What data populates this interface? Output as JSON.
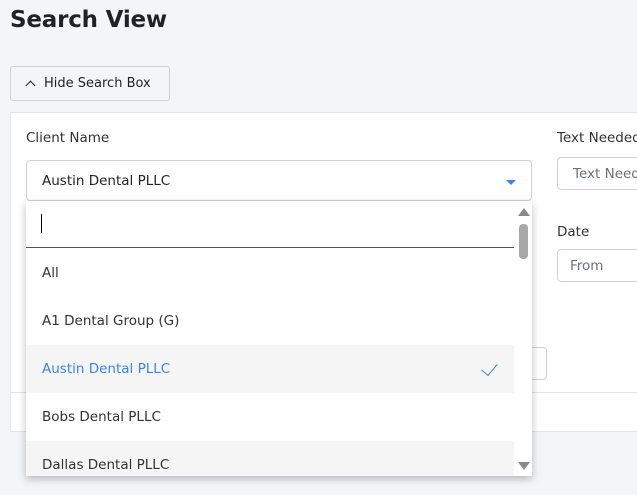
{
  "page": {
    "title": "Search View"
  },
  "toolbar": {
    "toggle_label": "Hide Search Box"
  },
  "form": {
    "client_name_label": "Client Name",
    "client_name_value": "Austin Dental PLLC",
    "text_needed_label": "Text Needed",
    "text_needed_placeholder": "Text Needed",
    "date_label": "Date",
    "date_from_placeholder": "From"
  },
  "dropdown": {
    "search_value": "",
    "options": [
      {
        "label": "All"
      },
      {
        "label": "A1 Dental Group (G)"
      },
      {
        "label": "Austin Dental PLLC",
        "selected": true
      },
      {
        "label": "Bobs Dental PLLC"
      },
      {
        "label": "Dallas Dental PLLC"
      }
    ]
  },
  "colors": {
    "accent": "#3b82f6",
    "selected_bg": "#f5f5f5"
  }
}
